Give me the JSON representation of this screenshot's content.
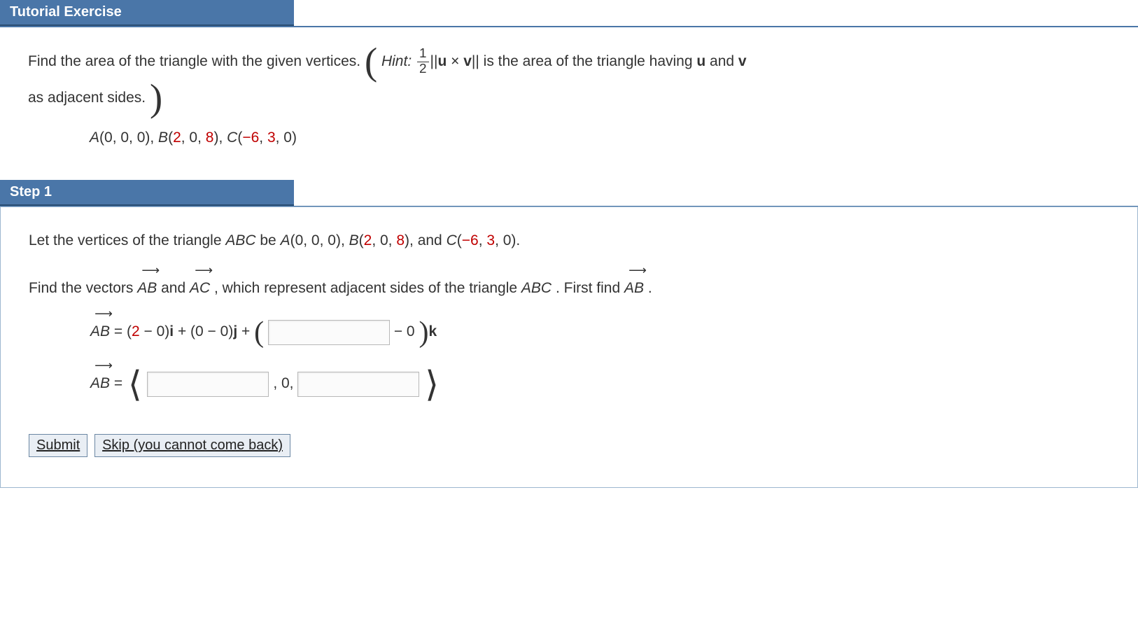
{
  "headers": {
    "tutorial": "Tutorial Exercise",
    "step1": "Step 1"
  },
  "problem": {
    "prompt_pre": "Find the area of the triangle with the given vertices. ",
    "hint_label": "Hint:",
    "frac_num": "1",
    "frac_den": "2",
    "hint_post": " is the area of the triangle having ",
    "u": "u",
    "v": "v",
    "and": " and ",
    "cross_sym": " × ",
    "norm_open": "||",
    "norm_close": "||",
    "as_adj": "as adjacent sides.",
    "vertices": {
      "A_label": "A",
      "A_coords_open": "(0, 0, 0), ",
      "B_label": "B",
      "B_open": "(",
      "B_x": "2",
      "B_mid": ", 0, ",
      "B_z": "8",
      "B_close": "), ",
      "C_label": "C",
      "C_open": "(",
      "C_x": "−6",
      "C_mid": ", ",
      "C_y": "3",
      "C_close": ", 0)"
    }
  },
  "step1": {
    "line1_pre": "Let the vertices of the triangle ",
    "ABC": "ABC",
    "line1_mid": " be ",
    "A_full": "A(0, 0, 0), ",
    "B_label": "B",
    "B_open": "(",
    "B_x": "2",
    "B_mid": ", 0, ",
    "B_z": "8",
    "B_close": "), and ",
    "C_label": "C",
    "C_open": "(",
    "C_x": "−6",
    "C_mid": ", ",
    "C_y": "3",
    "C_close": ", 0).",
    "line2_pre": "Find the vectors ",
    "AB": "AB",
    "line2_and": " and ",
    "AC": "AC",
    "line2_mid": ", which represent adjacent sides of the triangle ",
    "line2_post": ". First find ",
    "period": ".",
    "eq1": {
      "lhs": "AB",
      "eq": " = ",
      "i_term_open": "(",
      "i_term_x": "2",
      "i_term_rest": " − 0)",
      "i": "i",
      "plus1": " + (0 − 0)",
      "j": "j",
      "plus2": " + ",
      "k_tail": " − 0",
      "k": "k"
    },
    "eq2": {
      "lhs": "AB",
      "eq": " = ",
      "mid": ", 0, "
    }
  },
  "buttons": {
    "submit": "Submit",
    "skip": "Skip (you cannot come back)"
  }
}
